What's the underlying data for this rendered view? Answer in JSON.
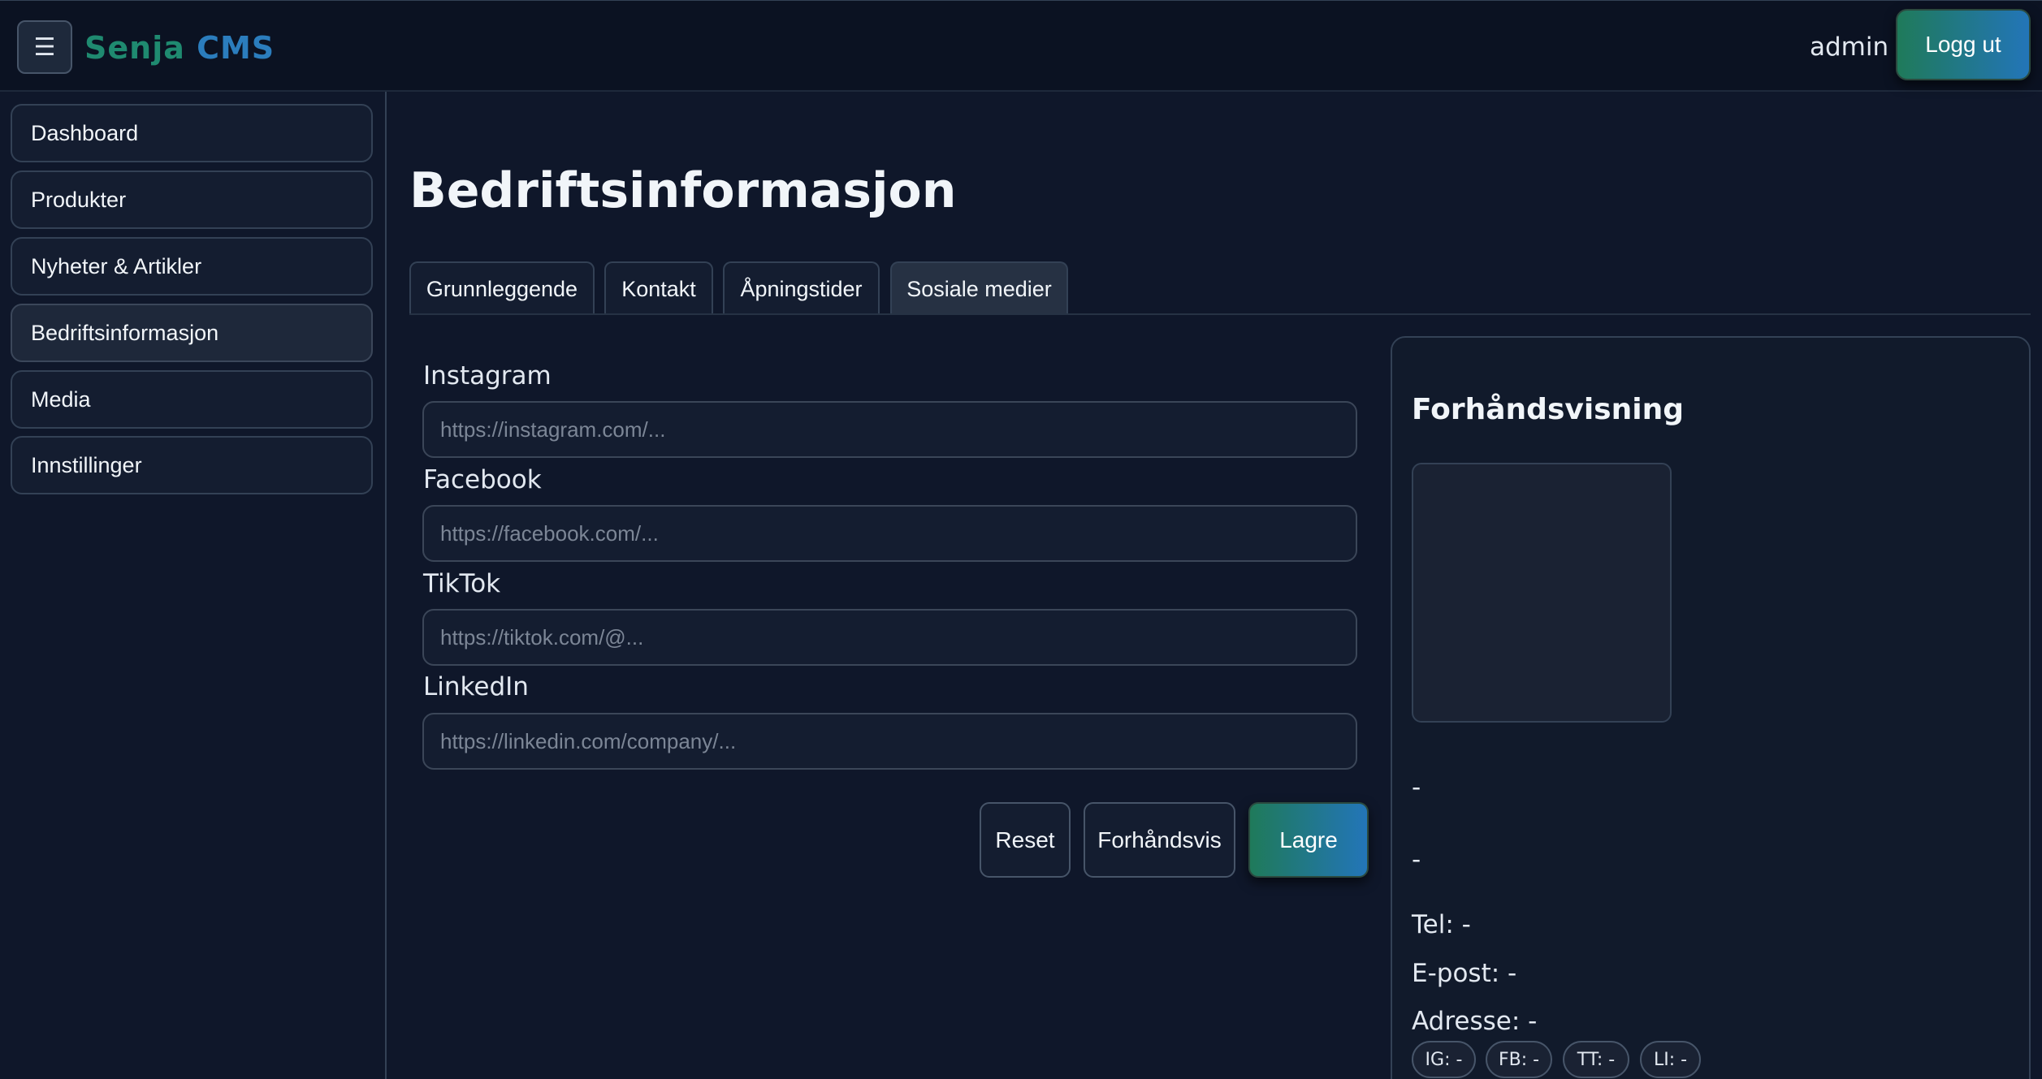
{
  "header": {
    "menu_icon": "☰",
    "brand_part1": "Senja",
    "brand_part2": "CMS",
    "brand_colors": [
      "#1f8a70",
      "#2b7dbd"
    ],
    "username": "admin",
    "logout_label": "Logg ut"
  },
  "sidebar": {
    "items": [
      {
        "label": "Dashboard"
      },
      {
        "label": "Produkter"
      },
      {
        "label": "Nyheter & Artikler"
      },
      {
        "label": "Bedriftsinformasjon",
        "active": true
      },
      {
        "label": "Media"
      },
      {
        "label": "Innstillinger"
      }
    ]
  },
  "main": {
    "title": "Bedriftsinformasjon",
    "tabs": [
      {
        "label": "Grunnleggende"
      },
      {
        "label": "Kontakt"
      },
      {
        "label": "Åpningstider"
      },
      {
        "label": "Sosiale medier",
        "active": true
      }
    ],
    "fields": [
      {
        "label": "Instagram",
        "value": "",
        "placeholder": "https://instagram.com/..."
      },
      {
        "label": "Facebook",
        "value": "",
        "placeholder": "https://facebook.com/..."
      },
      {
        "label": "TikTok",
        "value": "",
        "placeholder": "https://tiktok.com/@..."
      },
      {
        "label": "LinkedIn",
        "value": "",
        "placeholder": "https://linkedin.com/company/..."
      }
    ],
    "buttons": {
      "reset": "Reset",
      "preview": "Forhåndsvis",
      "save": "Lagre"
    }
  },
  "preview": {
    "title": "Forhåndsvisning",
    "name": "-",
    "description": "-",
    "phone": "Tel: -",
    "email": "E-post: -",
    "address": "Adresse: -",
    "chips": [
      "IG: -",
      "FB: -",
      "TT: -",
      "LI: -"
    ]
  },
  "colors": {
    "background": "#0f172a",
    "accent_gradient_start": "#1f7a5a",
    "accent_gradient_end": "#2375b8"
  }
}
